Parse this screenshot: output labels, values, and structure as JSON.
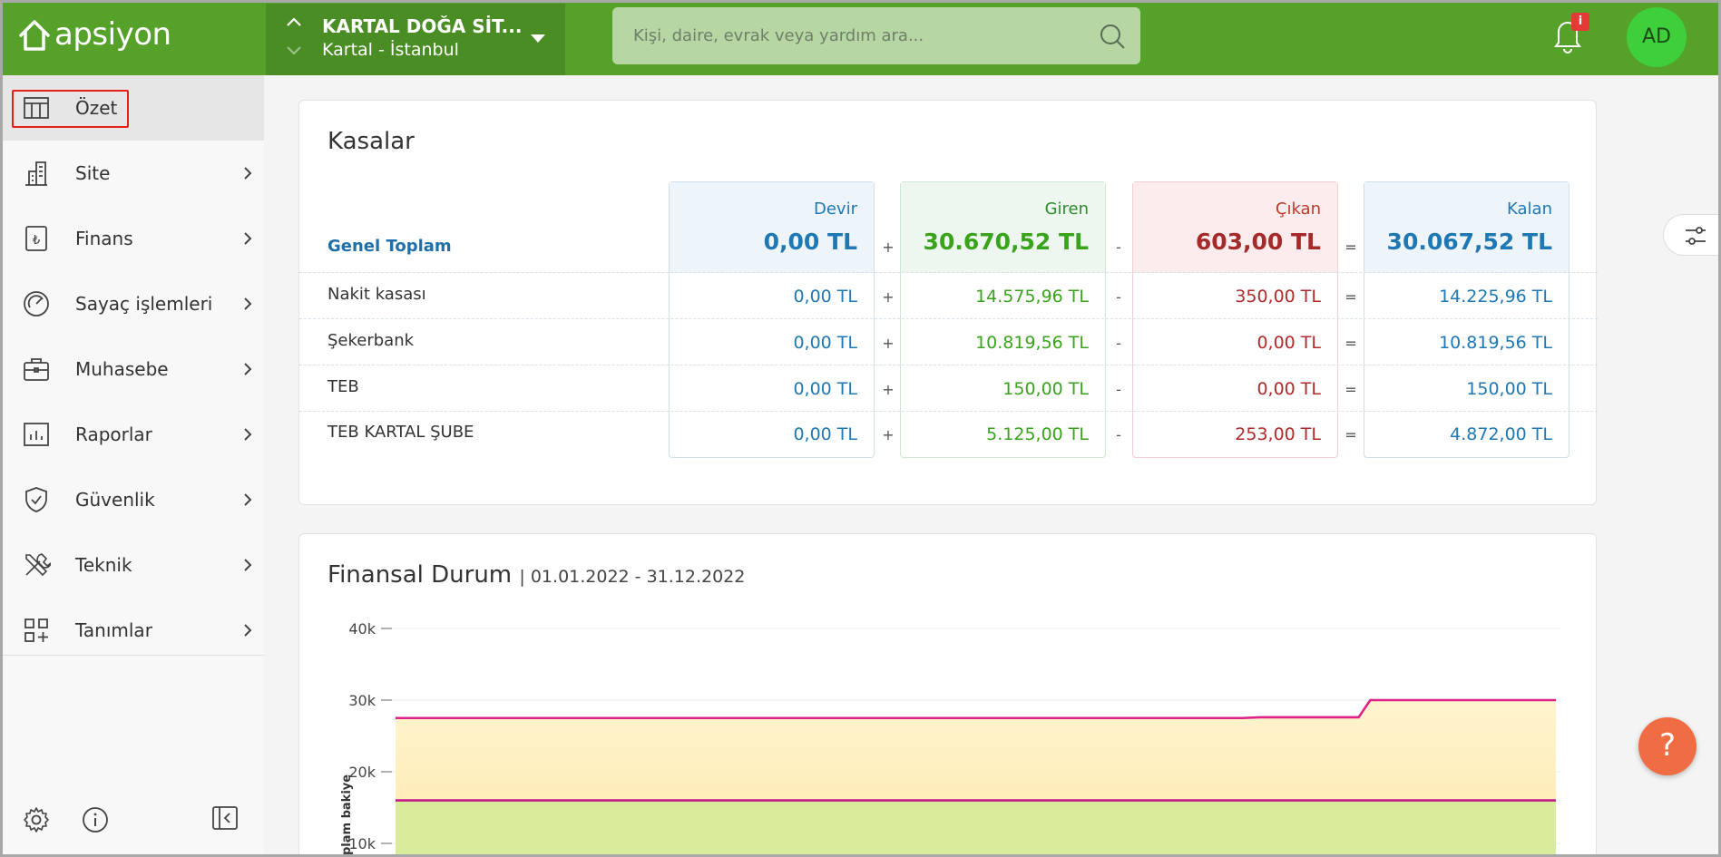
{
  "topbar": {
    "logo": "apsiyon",
    "site_name": "KARTAL DOĞA SİT...",
    "site_city": "Kartal - İstanbul",
    "search_placeholder": "Kişi, daire, evrak veya yardım ara...",
    "notif_badge": "i",
    "avatar": "AD"
  },
  "sidebar": {
    "items": [
      {
        "label": "Özet",
        "icon": "table-icon"
      },
      {
        "label": "Site",
        "icon": "building-icon"
      },
      {
        "label": "Finans",
        "icon": "lira-icon"
      },
      {
        "label": "Sayaç işlemleri",
        "icon": "gauge-icon"
      },
      {
        "label": "Muhasebe",
        "icon": "briefcase-icon"
      },
      {
        "label": "Raporlar",
        "icon": "chart-icon"
      },
      {
        "label": "Güvenlik",
        "icon": "shield-icon"
      },
      {
        "label": "Teknik",
        "icon": "tools-icon"
      },
      {
        "label": "Tanımlar",
        "icon": "grid-plus-icon"
      }
    ]
  },
  "kasalar": {
    "title": "Kasalar",
    "total_label": "Genel Toplam",
    "headers": {
      "devir": {
        "label": "Devir",
        "value": "0,00 TL"
      },
      "giren": {
        "label": "Giren",
        "value": "30.670,52 TL"
      },
      "cikan": {
        "label": "Çıkan",
        "value": "603,00 TL"
      },
      "kalan": {
        "label": "Kalan",
        "value": "30.067,52 TL"
      }
    },
    "ops": {
      "plus": "+",
      "minus": "-",
      "equals": "="
    },
    "rows": [
      {
        "name": "Nakit kasası",
        "devir": "0,00 TL",
        "giren": "14.575,96 TL",
        "cikan": "350,00 TL",
        "kalan": "14.225,96 TL"
      },
      {
        "name": "Şekerbank",
        "devir": "0,00 TL",
        "giren": "10.819,56 TL",
        "cikan": "0,00 TL",
        "kalan": "10.819,56 TL"
      },
      {
        "name": "TEB",
        "devir": "0,00 TL",
        "giren": "150,00 TL",
        "cikan": "0,00 TL",
        "kalan": "150,00 TL"
      },
      {
        "name": "TEB KARTAL ŞUBE",
        "devir": "0,00 TL",
        "giren": "5.125,00 TL",
        "cikan": "253,00 TL",
        "kalan": "4.872,00 TL"
      }
    ],
    "colors": {
      "devir": "#1f78b4",
      "giren": "#3aa31c",
      "cikan": "#b02a2a",
      "kalan": "#1f78b4"
    }
  },
  "finansal": {
    "title": "Finansal Durum",
    "range": "| 01.01.2022 - 31.12.2022"
  },
  "chart_data": {
    "type": "area",
    "title": "",
    "ylabel": "Toplam bakiye",
    "xlabel": "",
    "yticks": [
      "10k",
      "20k",
      "30k",
      "40k"
    ],
    "ylim": [
      10000,
      40000
    ],
    "x": [
      0,
      0.73,
      0.745,
      0.82,
      0.83,
      0.84,
      1.0
    ],
    "series": [
      {
        "values": [
          27500,
          27500,
          27600,
          27600,
          27600,
          30000,
          30000
        ],
        "color": "#e0218a",
        "fill": "#fde9a8"
      },
      {
        "values": [
          16000,
          16000,
          16000,
          16000,
          16000,
          16000,
          16000
        ],
        "color": "#c01a8a",
        "fill": "#d9ec9c"
      }
    ],
    "grid": true
  },
  "help_label": "?"
}
